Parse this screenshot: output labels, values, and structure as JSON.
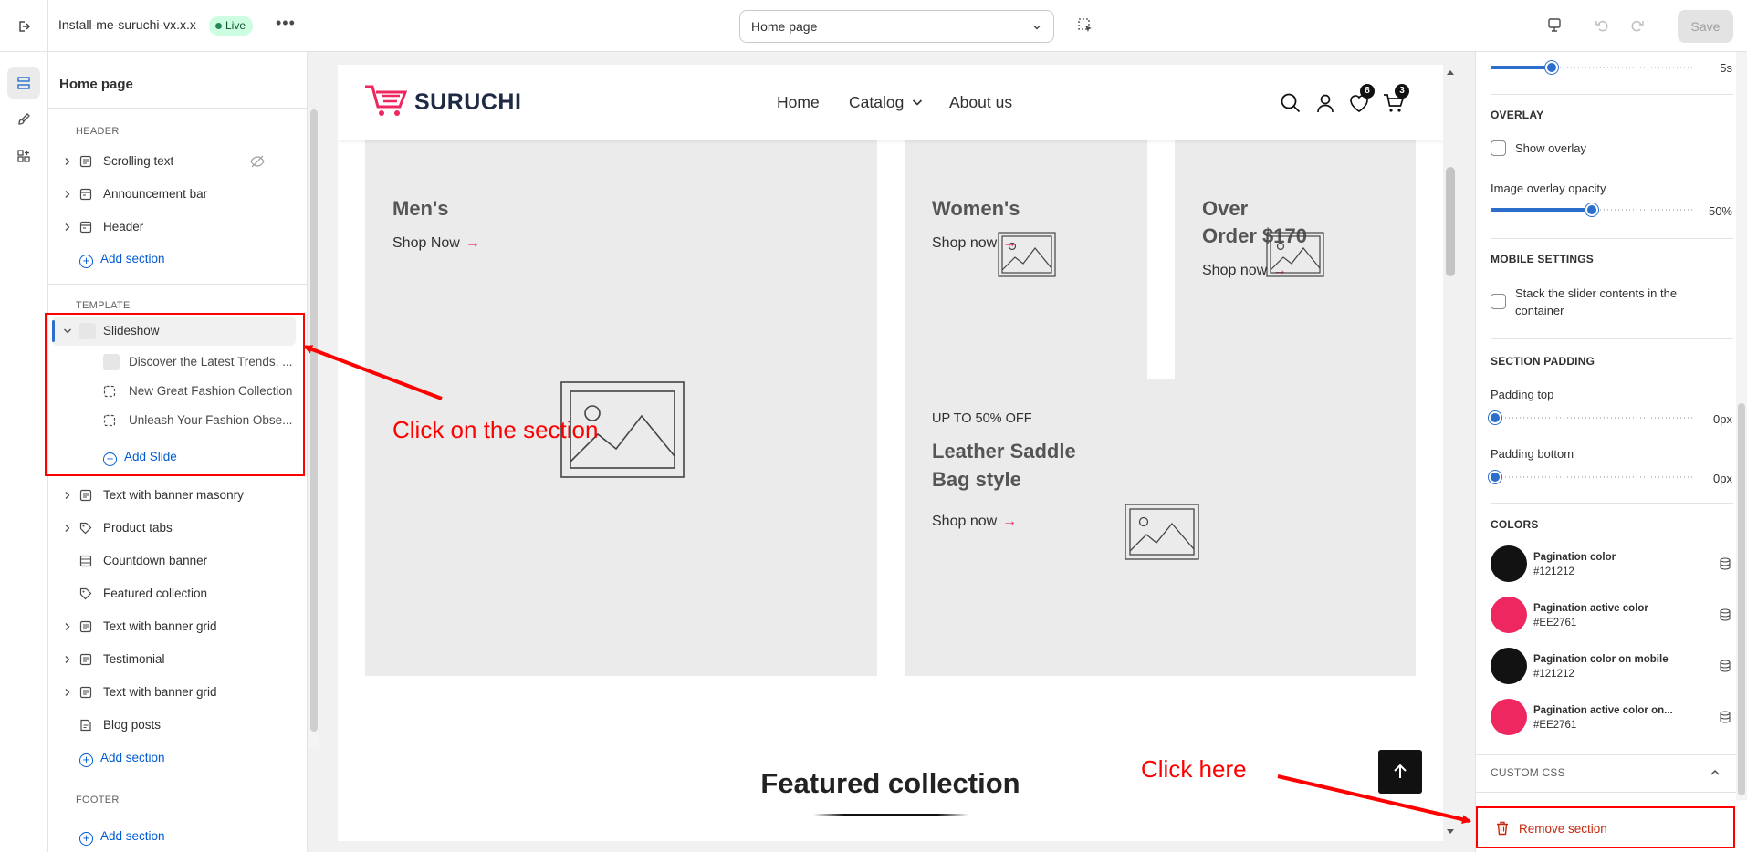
{
  "topbar": {
    "theme_name": "Install-me-suruchi-vx.x.x",
    "status_badge": "Live",
    "page_select_value": "Home page",
    "save_label": "Save"
  },
  "left_panel": {
    "title": "Home page",
    "header_group_label": "HEADER",
    "header_items": [
      {
        "label": "Scrolling text"
      },
      {
        "label": "Announcement bar"
      },
      {
        "label": "Header"
      }
    ],
    "add_section_label": "Add section",
    "template_group_label": "TEMPLATE",
    "slideshow": {
      "label": "Slideshow",
      "slides": [
        {
          "label": "Discover the Latest Trends, ..."
        },
        {
          "label": "New Great Fashion Collection"
        },
        {
          "label": "Unleash Your Fashion Obse..."
        }
      ],
      "add_slide_label": "Add Slide"
    },
    "template_items": [
      {
        "label": "Text with banner masonry"
      },
      {
        "label": "Product tabs"
      },
      {
        "label": "Countdown banner"
      },
      {
        "label": "Featured collection"
      },
      {
        "label": "Text with banner grid"
      },
      {
        "label": "Testimonial"
      },
      {
        "label": "Text with banner grid"
      },
      {
        "label": "Blog posts"
      }
    ],
    "footer_group_label": "FOOTER"
  },
  "preview": {
    "logo": "SURUCHI",
    "nav": [
      {
        "label": "Home"
      },
      {
        "label": "Catalog"
      },
      {
        "label": "About us"
      }
    ],
    "wishlist_count": "8",
    "cart_count": "3",
    "tiles": {
      "men_title": "Men's",
      "men_link": "Shop Now",
      "women_title": "Women's",
      "women_link": "Shop now",
      "offer_title_1": "Over",
      "offer_title_2": "Order $170",
      "offer_link": "Shop now",
      "leather_kicker": "UP TO 50% OFF",
      "leather_title_1": "Leather Saddle",
      "leather_title_2": "Bag style",
      "leather_link": "Shop now"
    },
    "featured_title": "Featured collection"
  },
  "right_panel": {
    "top_slider_value": "5s",
    "top_slider_fraction": 0.3,
    "overlay_heading": "OVERLAY",
    "show_overlay_label": "Show overlay",
    "opacity_label": "Image overlay opacity",
    "opacity_value": "50%",
    "opacity_fraction": 0.5,
    "mobile_heading": "MOBILE SETTINGS",
    "stack_label": "Stack the slider contents in the container",
    "padding_heading": "SECTION PADDING",
    "padding_top_label": "Padding top",
    "padding_top_value": "0px",
    "padding_bottom_label": "Padding bottom",
    "padding_bottom_value": "0px",
    "colors_heading": "COLORS",
    "colors": [
      {
        "name": "Pagination color",
        "hex": "#121212",
        "swatch": "#121212"
      },
      {
        "name": "Pagination active color",
        "hex": "#EE2761",
        "swatch": "#EE2761"
      },
      {
        "name": "Pagination color on mobile",
        "hex": "#121212",
        "swatch": "#121212"
      },
      {
        "name": "Pagination active color on...",
        "hex": "#EE2761",
        "swatch": "#EE2761"
      }
    ],
    "custom_css_heading": "CUSTOM CSS",
    "remove_label": "Remove section"
  },
  "annotations": {
    "click_section": "Click on the section",
    "click_here": "Click here"
  },
  "colors": {
    "accent": "#005bd3",
    "brand_pink": "#EE2761",
    "annotation_red": "#ff0000",
    "danger": "#c5280c"
  }
}
